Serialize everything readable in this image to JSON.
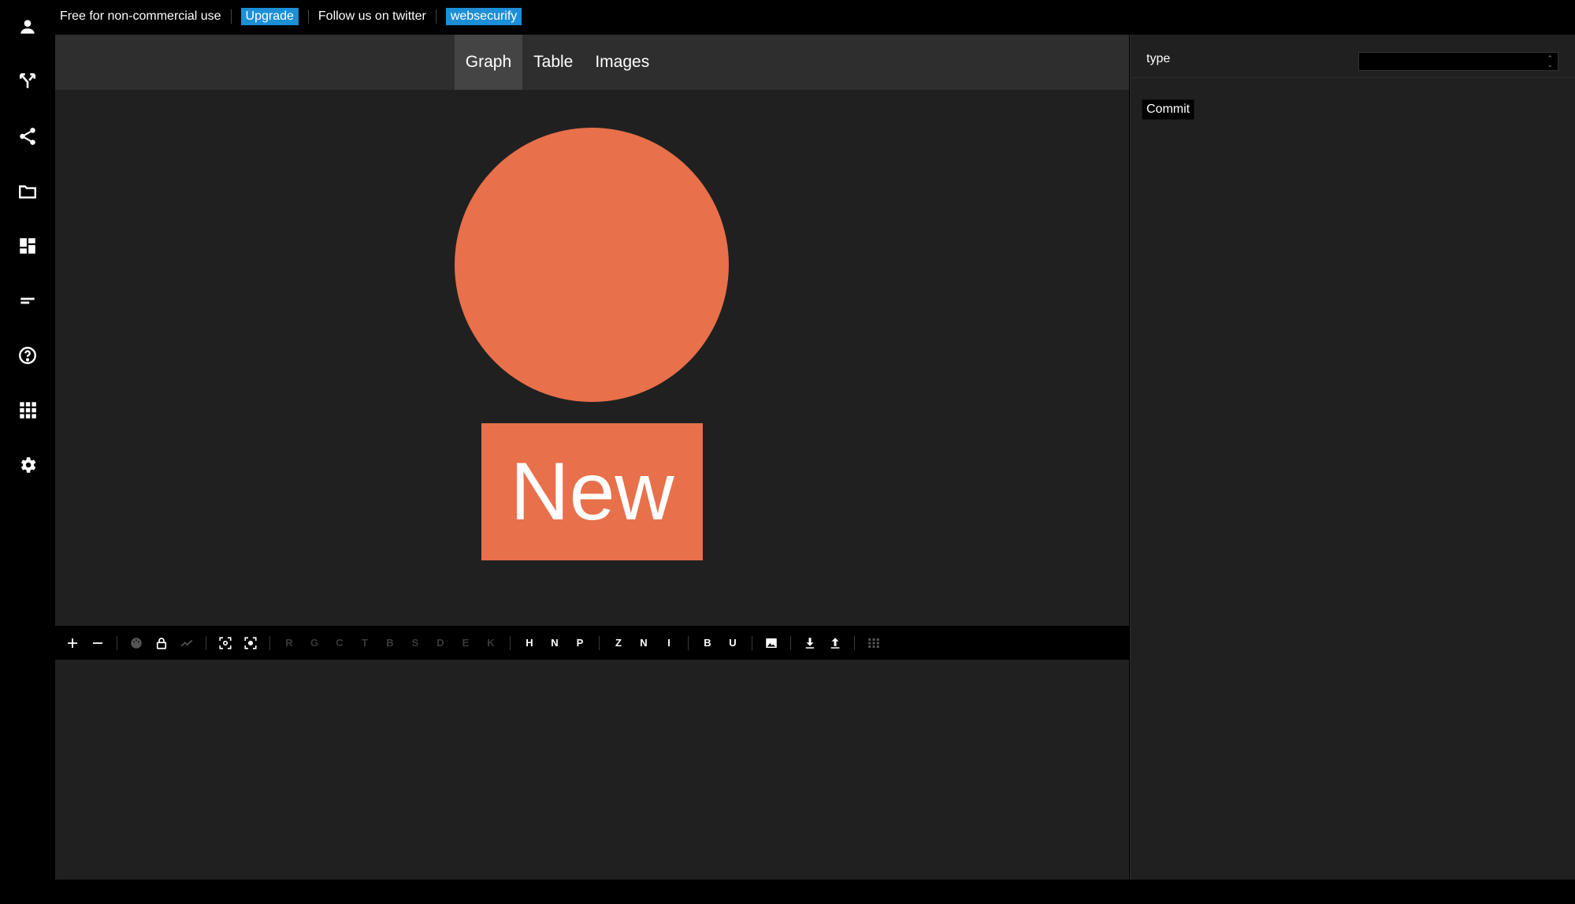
{
  "topbar": {
    "license_text": "Free for non-commercial use",
    "upgrade_label": "Upgrade",
    "follow_text": "Follow us on twitter",
    "twitter_handle": "websecurify"
  },
  "sidebar": {
    "icons": [
      "user-icon",
      "merge-icon",
      "share-icon",
      "folder-icon",
      "dashboard-icon",
      "text-lines-icon",
      "help-icon",
      "apps-grid-icon",
      "settings-gear-icon"
    ]
  },
  "tabs": [
    "Graph",
    "Table",
    "Images"
  ],
  "active_tab": "Graph",
  "canvas": {
    "node_label": "New",
    "node_color": "#e8704a"
  },
  "toolbar": {
    "letters_group1": [
      "R",
      "G",
      "C",
      "T",
      "B",
      "S",
      "D",
      "E",
      "K"
    ],
    "letters_group2": [
      "H",
      "N",
      "P"
    ],
    "letters_group3": [
      "Z",
      "N",
      "I"
    ],
    "letters_group4": [
      "B",
      "U"
    ]
  },
  "properties": {
    "type_label": "type",
    "type_value": "",
    "commit_label": "Commit"
  },
  "colors": {
    "accent_blue": "#1c8fd6",
    "node_orange": "#e8704a",
    "panel_bg": "#202020"
  }
}
